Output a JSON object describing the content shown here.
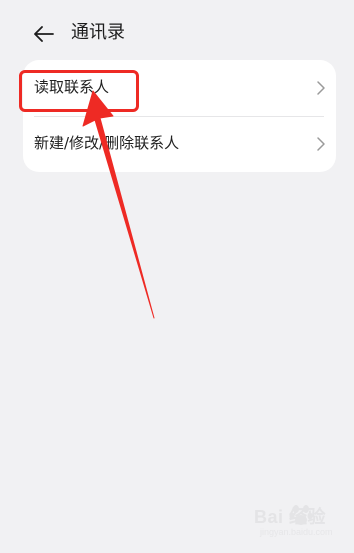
{
  "header": {
    "title": "通讯录",
    "back_icon": "arrow-left-icon"
  },
  "list": {
    "items": [
      {
        "label": "读取联系人",
        "icon": "chevron-right-icon"
      },
      {
        "label": "新建/修改/删除联系人",
        "icon": "chevron-right-icon"
      }
    ]
  },
  "annotation": {
    "color": "#ee2a24"
  },
  "watermark": {
    "brand": "Bai  经验",
    "url": "jingyan.baidu.com"
  }
}
